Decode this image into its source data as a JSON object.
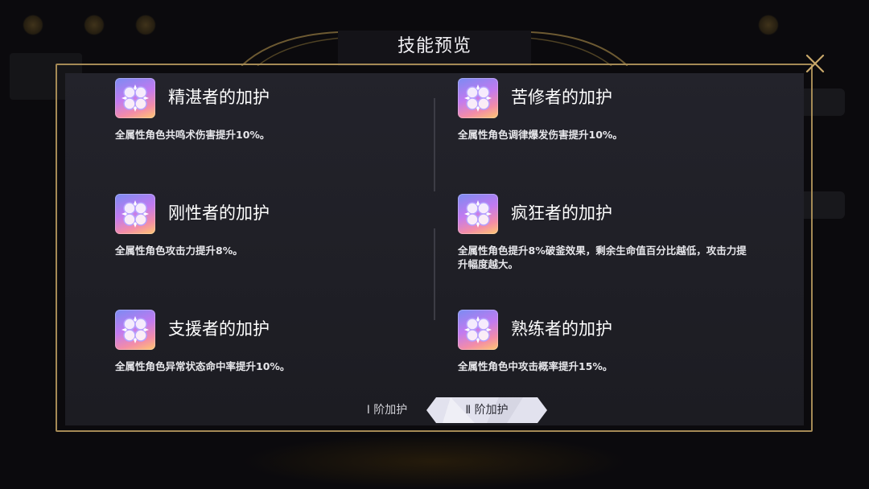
{
  "modal": {
    "title": "技能预览"
  },
  "skills": [
    {
      "name": "精湛者的加护",
      "desc": "全属性角色共鸣术伤害提升10%。"
    },
    {
      "name": "苦修者的加护",
      "desc": "全属性角色调律爆发伤害提升10%。"
    },
    {
      "name": "刚性者的加护",
      "desc": "全属性角色攻击力提升8%。"
    },
    {
      "name": "疯狂者的加护",
      "desc": "全属性角色提升8%破釜效果，剩余生命值百分比越低，攻击力提升幅度越大。"
    },
    {
      "name": "支援者的加护",
      "desc": "全属性角色异常状态命中率提升10%。"
    },
    {
      "name": "熟练者的加护",
      "desc": "全属性角色中攻击概率提升15%。"
    }
  ],
  "tabs": [
    {
      "label": "Ⅰ 阶加护",
      "selected": false
    },
    {
      "label": "Ⅱ 阶加护",
      "selected": true
    }
  ],
  "colors": {
    "frame_gold": "#a58a55",
    "panel": "#1f1f26",
    "selected_tab": "#e2e2ee"
  },
  "icons": {
    "skill": "four-orb-emblem-icon",
    "close": "close-x-icon"
  }
}
